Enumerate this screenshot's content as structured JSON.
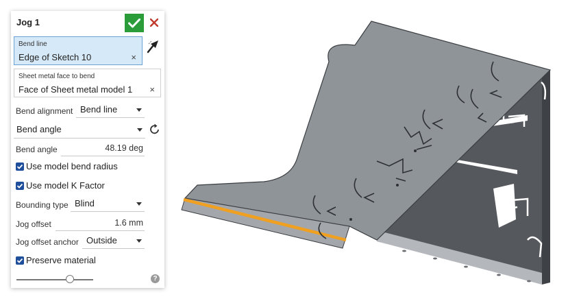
{
  "feature": {
    "title": "Jog 1",
    "bend_line": {
      "label": "Bend line",
      "value": "Edge of Sketch 10",
      "clear": "×"
    },
    "face_to_bend": {
      "label": "Sheet metal face to bend",
      "value": "Face of Sheet metal model 1",
      "clear": "×"
    },
    "bend_alignment": {
      "label": "Bend alignment",
      "value": "Bend line"
    },
    "bend_mode": {
      "value": "Bend angle"
    },
    "bend_angle": {
      "label": "Bend angle",
      "value": "48.19 deg"
    },
    "use_model_bend_radius": {
      "label": "Use model bend radius",
      "checked": true
    },
    "use_model_k_factor": {
      "label": "Use model K Factor",
      "checked": true
    },
    "bounding_type": {
      "label": "Bounding type",
      "value": "Blind"
    },
    "jog_offset": {
      "label": "Jog offset",
      "value": "1.6 mm"
    },
    "jog_offset_anchor": {
      "label": "Jog offset anchor",
      "value": "Outside"
    },
    "preserve_material": {
      "label": "Preserve material",
      "checked": true
    },
    "slider_level": 0.7,
    "help": "?"
  },
  "colors": {
    "accept": "#2a9d3a",
    "cancel": "#c0392b",
    "checkbox": "#1f4e9a",
    "selection_active": "#d6e9f8",
    "part": "#8f9499",
    "highlight_edge": "#f0a020"
  },
  "icons": [
    "check-icon",
    "close-icon",
    "selection-arrow-icon",
    "flip-direction-icon",
    "help-icon"
  ]
}
